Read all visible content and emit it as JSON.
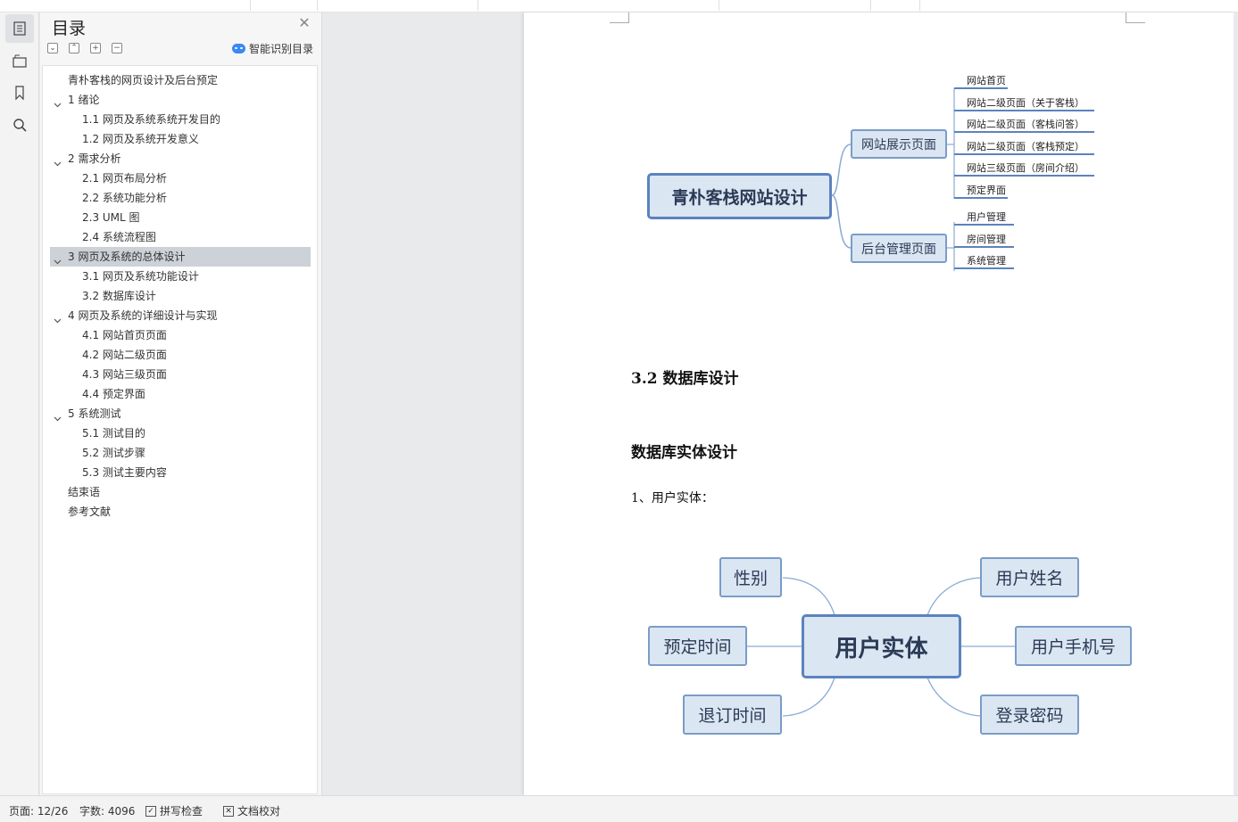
{
  "outline_panel": {
    "title": "目录",
    "smart_label": "智能识别目录",
    "items": [
      {
        "label": "青朴客栈的网页设计及后台预定",
        "level": 0,
        "expandable": false,
        "selected": false
      },
      {
        "label": "1  绪论",
        "level": 1,
        "expandable": true,
        "selected": false
      },
      {
        "label": "1.1 网页及系统系统开发目的",
        "level": 2,
        "expandable": false,
        "selected": false
      },
      {
        "label": "1.2 网页及系统开发意义",
        "level": 2,
        "expandable": false,
        "selected": false
      },
      {
        "label": "2  需求分析",
        "level": 1,
        "expandable": true,
        "selected": false
      },
      {
        "label": "2.1  网页布局分析",
        "level": 2,
        "expandable": false,
        "selected": false
      },
      {
        "label": "2.2  系统功能分析",
        "level": 2,
        "expandable": false,
        "selected": false
      },
      {
        "label": "2.3 UML 图",
        "level": 2,
        "expandable": false,
        "selected": false
      },
      {
        "label": "2.4  系统流程图",
        "level": 2,
        "expandable": false,
        "selected": false
      },
      {
        "label": "3  网页及系统的总体设计",
        "level": 1,
        "expandable": true,
        "selected": true
      },
      {
        "label": "3.1  网页及系统功能设计",
        "level": 2,
        "expandable": false,
        "selected": false
      },
      {
        "label": "3.2  数据库设计",
        "level": 2,
        "expandable": false,
        "selected": false
      },
      {
        "label": "4  网页及系统的详细设计与实现",
        "level": 1,
        "expandable": true,
        "selected": false
      },
      {
        "label": "4.1  网站首页页面",
        "level": 2,
        "expandable": false,
        "selected": false
      },
      {
        "label": "4.2  网站二级页面",
        "level": 2,
        "expandable": false,
        "selected": false
      },
      {
        "label": "4.3  网站三级页面",
        "level": 2,
        "expandable": false,
        "selected": false
      },
      {
        "label": "4.4  预定界面",
        "level": 2,
        "expandable": false,
        "selected": false
      },
      {
        "label": "5  系统测试",
        "level": 1,
        "expandable": true,
        "selected": false
      },
      {
        "label": "5.1  测试目的",
        "level": 2,
        "expandable": false,
        "selected": false
      },
      {
        "label": "5.2  测试步骤",
        "level": 2,
        "expandable": false,
        "selected": false
      },
      {
        "label": "5.3  测试主要内容",
        "level": 2,
        "expandable": false,
        "selected": false
      },
      {
        "label": "结束语",
        "level": 1,
        "expandable": false,
        "selected": false
      },
      {
        "label": "参考文献",
        "level": 1,
        "expandable": false,
        "selected": false
      }
    ]
  },
  "document": {
    "mindmap1": {
      "root": "青朴客栈网站设计",
      "branch_front": "网站展示页面",
      "branch_back": "后台管理页面",
      "front_leaves": [
        "网站首页",
        "网站二级页面（关于客栈）",
        "网站二级页面（客栈问答）",
        "网站二级页面（客栈预定）",
        "网站三级页面（房间介绍）",
        "预定界面"
      ],
      "back_leaves": [
        "用户管理",
        "房间管理",
        "系统管理"
      ]
    },
    "heading": "3.2  数据库设计",
    "subheading": "数据库实体设计",
    "paragraph": "1、用户实体：",
    "mindmap2": {
      "center": "用户实体",
      "left": [
        "性别",
        "预定时间",
        "退订时间"
      ],
      "right": [
        "用户姓名",
        "用户手机号",
        "登录密码"
      ]
    }
  },
  "status_bar": {
    "page": "页面: 12/26",
    "words": "字数: 4096",
    "spellcheck": "拼写检查",
    "proofread": "文档校对"
  },
  "colors": {
    "node_fill": "#dbe6f3",
    "node_border": "#7a9cc8",
    "root_border": "#5b83bd",
    "selected_row": "#cdd1d8"
  }
}
